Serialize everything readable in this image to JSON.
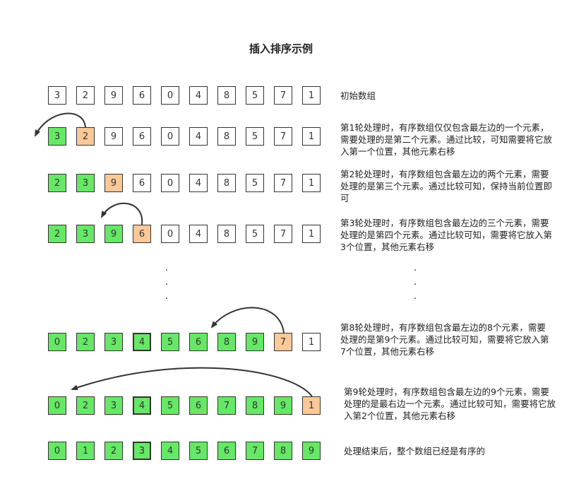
{
  "title": "插入排序示例",
  "rows": [
    {
      "values": [
        "3",
        "2",
        "9",
        "6",
        "0",
        "4",
        "8",
        "5",
        "7",
        "1"
      ],
      "states": [
        "",
        "",
        "",
        "",
        "",
        "",
        "",
        "",
        "",
        ""
      ],
      "note": "初始数组"
    },
    {
      "values": [
        "3",
        "2",
        "9",
        "6",
        "0",
        "4",
        "8",
        "5",
        "7",
        "1"
      ],
      "states": [
        "sorted",
        "current",
        "",
        "",
        "",
        "",
        "",
        "",
        "",
        ""
      ],
      "note": "第1轮处理时，有序数组仅仅包含最左边的一个元素，需要处理的是第二个元素。通过比较，可知需要将它放入第一个位置，其他元素右移"
    },
    {
      "values": [
        "2",
        "3",
        "9",
        "6",
        "0",
        "4",
        "8",
        "5",
        "7",
        "1"
      ],
      "states": [
        "sorted",
        "sorted",
        "current",
        "",
        "",
        "",
        "",
        "",
        "",
        ""
      ],
      "note": "第2轮处理时，有序数组包含最左边的两个元素，需要处理的是第三个元素。通过比较可知，保持当前位置即可"
    },
    {
      "values": [
        "2",
        "3",
        "9",
        "6",
        "0",
        "4",
        "8",
        "5",
        "7",
        "1"
      ],
      "states": [
        "sorted",
        "sorted",
        "sorted",
        "current",
        "",
        "",
        "",
        "",
        "",
        ""
      ],
      "note": "第3轮处理时，有序数组包含最左边的三个元素，需要处理的是第四个元素。通过比较可知，需要将它放入第3个位置，其他元素右移"
    },
    {
      "values": [
        "0",
        "2",
        "3",
        "4",
        "5",
        "6",
        "8",
        "9",
        "7",
        "1"
      ],
      "states": [
        "sorted",
        "sorted",
        "sorted",
        "sorted",
        "sorted",
        "sorted",
        "sorted",
        "sorted",
        "current",
        ""
      ],
      "note": "第8轮处理时，有序数组包含最左边的8个元素，需要处理的是第9个元素。通过比较可知，需要将它放入第7个位置，其他元素右移"
    },
    {
      "values": [
        "0",
        "2",
        "3",
        "4",
        "5",
        "6",
        "7",
        "8",
        "9",
        "1"
      ],
      "states": [
        "sorted",
        "sorted",
        "sorted",
        "sorted",
        "sorted",
        "sorted",
        "sorted",
        "sorted",
        "sorted",
        "current"
      ],
      "note": "第9轮处理时，有序数组包含最左边的9个元素，需要处理的是最右边一个元素。通过比较可知，需要将它放入第2个位置，其他元素右移"
    },
    {
      "values": [
        "0",
        "1",
        "2",
        "3",
        "4",
        "5",
        "6",
        "7",
        "8",
        "9"
      ],
      "states": [
        "sorted",
        "sorted",
        "sorted",
        "sorted",
        "sorted",
        "sorted",
        "sorted",
        "sorted",
        "sorted",
        "sorted"
      ],
      "note": "处理结束后，整个数组已经是有序的"
    }
  ],
  "ellipsis": "·"
}
